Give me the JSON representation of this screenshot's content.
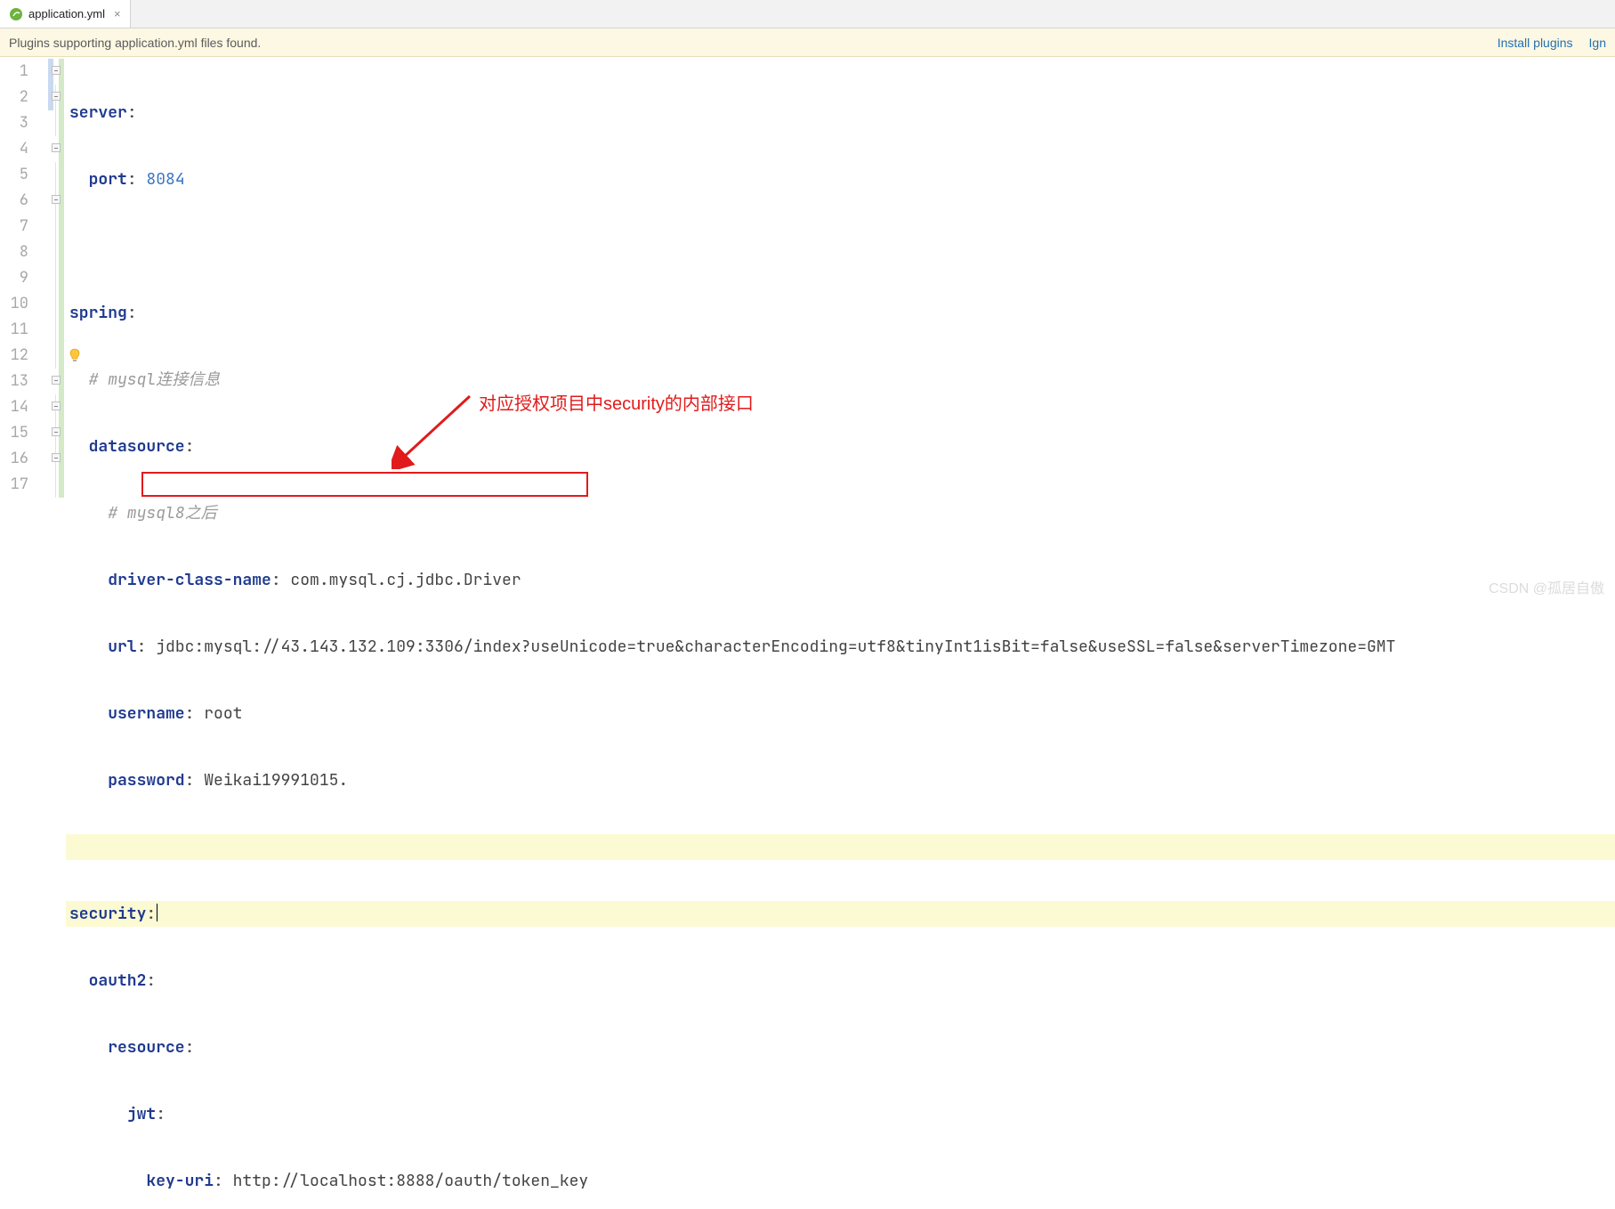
{
  "tab": {
    "filename": "application.yml"
  },
  "notification": {
    "message": "Plugins supporting application.yml files found.",
    "install": "Install plugins",
    "ignore": "Ign"
  },
  "lines": {
    "l1": "1",
    "l2": "2",
    "l3": "3",
    "l4": "4",
    "l5": "5",
    "l6": "6",
    "l7": "7",
    "l8": "8",
    "l9": "9",
    "l10": "10",
    "l11": "11",
    "l12": "12",
    "l13": "13",
    "l14": "14",
    "l15": "15",
    "l16": "16",
    "l17": "17"
  },
  "code": {
    "server": "server",
    "port_k": "port",
    "port_v": "8084",
    "spring": "spring",
    "cmt1": "# mysql连接信息",
    "datasource": "datasource",
    "cmt2": "# mysql8之后",
    "driver_k": "driver-class-name",
    "driver_v": "com.mysql.cj.jdbc.Driver",
    "url_k": "url",
    "url_v": "jdbc:mysql://43.143.132.109:3306/index?useUnicode=true&characterEncoding=utf8&tinyInt1isBit=false&useSSL=false&serverTimezone=GMT",
    "username_k": "username",
    "username_v": "root",
    "password_k": "password",
    "password_v": "Weikai19991015.",
    "security": "security",
    "oauth2": "oauth2",
    "resource": "resource",
    "jwt": "jwt",
    "keyuri_k": "key-uri",
    "keyuri_v": "http://localhost:8888/oauth/token_key"
  },
  "annotation": {
    "text": "对应授权项目中security的内部接口"
  },
  "watermark": "CSDN @孤居自傲"
}
